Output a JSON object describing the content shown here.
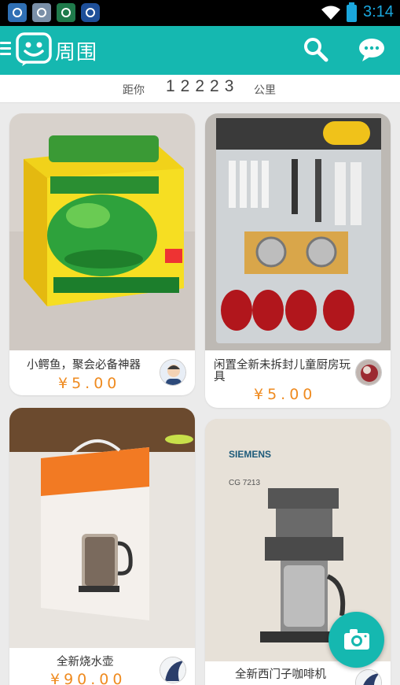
{
  "status_bar": {
    "time": "3:14"
  },
  "header": {
    "app_title": "周围",
    "menu_icon": "hamburger-icon",
    "logo_icon": "smiley-logo-icon",
    "search_icon": "search-icon",
    "chat_icon": "chat-bubble-icon"
  },
  "distance": {
    "prefix": "距你",
    "value": "12223",
    "unit": "公里"
  },
  "listings": [
    {
      "title": "小鳄鱼，聚会必备神器",
      "price": "¥5.00",
      "image": "crocodile-dentist-toy-box"
    },
    {
      "title": "闲置全新未拆封儿童厨房玩具",
      "price": "¥5.00",
      "image": "kitchen-toy-set-package"
    },
    {
      "title": "全新烧水壶",
      "price": "¥90.00",
      "image": "longde-electric-kettle-box"
    },
    {
      "title": "全新西门子咖啡机",
      "price": "",
      "image": "siemens-coffee-maker-box"
    }
  ],
  "fab": {
    "icon": "camera-icon"
  },
  "colors": {
    "brand": "#15b8b0",
    "price": "#ef8b20"
  }
}
